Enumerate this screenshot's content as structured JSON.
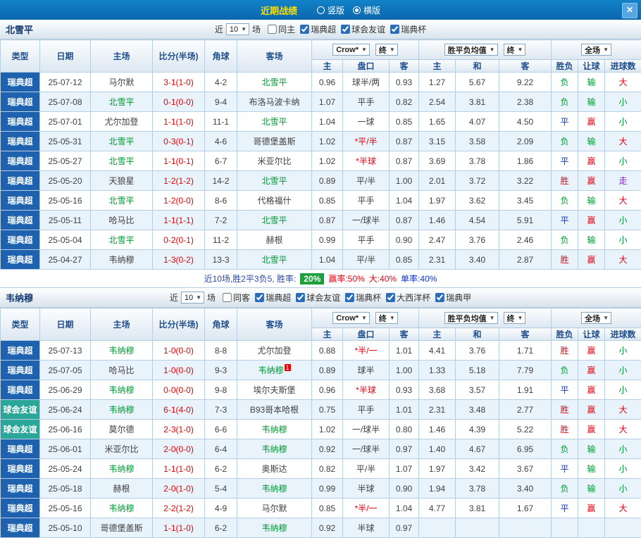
{
  "topbar": {
    "title": "近期战绩",
    "layout_options": [
      {
        "label": "竖版",
        "checked": false
      },
      {
        "label": "横版",
        "checked": true
      }
    ],
    "close_label": "✕"
  },
  "colors": {
    "accent_blue": "#1e61ae",
    "friendly_teal": "#2ba79a",
    "win_red": "#e60012",
    "loss_green": "#009933",
    "draw_blue": "#1133cc",
    "push_purple": "#7d2cc8",
    "title_yellow": "#ffdf00",
    "badge_green": "#1ca03c"
  },
  "sections": [
    {
      "team": "北雪平",
      "filter": {
        "near_label": "近",
        "count_value": "10",
        "games_label": "场",
        "checkboxes": [
          {
            "label": "同主",
            "checked": false
          },
          {
            "label": "瑞典超",
            "checked": true
          },
          {
            "label": "球会友谊",
            "checked": true
          },
          {
            "label": "瑞典杯",
            "checked": true
          }
        ]
      },
      "table": {
        "header": {
          "type": "类型",
          "date": "日期",
          "home": "主场",
          "score": "比分(半场)",
          "corner": "角球",
          "away": "客场",
          "dd_odds": "Crow*",
          "dd_odds_final": "终",
          "dd_avg": "胜平负均值",
          "dd_avg_final": "终",
          "dd_scope": "全场",
          "sub_home": "主",
          "sub_handicap": "盘口",
          "sub_away": "客",
          "sub_avg_home": "主",
          "sub_avg_draw": "和",
          "sub_avg_away": "客",
          "sub_result": "胜负",
          "sub_hcap": "让球",
          "sub_goals": "进球数"
        },
        "rows": [
          {
            "type": "瑞典超",
            "type_cls": "lg-super",
            "date": "25-07-12",
            "home": "马尔默",
            "home_cls": "",
            "score": "3-1(1-0)",
            "corner": "4-2",
            "away": "北雪平",
            "away_cls": "team-focus",
            "away_badge": "",
            "o1": "0.96",
            "hcp": "球半/两",
            "hcp_cls": "",
            "o2": "0.93",
            "a1": "1.27",
            "a2": "5.67",
            "a3": "9.22",
            "res": "负",
            "res_cls": "green",
            "hc": "输",
            "hc_cls": "green",
            "gl": "大",
            "gl_cls": "red"
          },
          {
            "type": "瑞典超",
            "type_cls": "lg-super",
            "date": "25-07-08",
            "home": "北雪平",
            "home_cls": "team-focus",
            "score": "0-1(0-0)",
            "corner": "9-4",
            "away": "布洛马波卡纳",
            "away_cls": "",
            "away_badge": "",
            "o1": "1.07",
            "hcp": "平手",
            "hcp_cls": "",
            "o2": "0.82",
            "a1": "2.54",
            "a2": "3.81",
            "a3": "2.38",
            "res": "负",
            "res_cls": "green",
            "hc": "输",
            "hc_cls": "green",
            "gl": "小",
            "gl_cls": "green"
          },
          {
            "type": "瑞典超",
            "type_cls": "lg-super",
            "date": "25-07-01",
            "home": "尤尔加登",
            "home_cls": "",
            "score": "1-1(1-0)",
            "corner": "11-1",
            "away": "北雪平",
            "away_cls": "team-focus",
            "away_badge": "",
            "o1": "1.04",
            "hcp": "一球",
            "hcp_cls": "",
            "o2": "0.85",
            "a1": "1.65",
            "a2": "4.07",
            "a3": "4.50",
            "res": "平",
            "res_cls": "blue",
            "hc": "赢",
            "hc_cls": "red",
            "gl": "小",
            "gl_cls": "green"
          },
          {
            "type": "瑞典超",
            "type_cls": "lg-super",
            "date": "25-05-31",
            "home": "北雪平",
            "home_cls": "team-focus",
            "score": "0-3(0-1)",
            "corner": "4-6",
            "away": "哥德堡盖斯",
            "away_cls": "",
            "away_badge": "",
            "o1": "1.02",
            "hcp": "*平/半",
            "hcp_cls": "red",
            "o2": "0.87",
            "a1": "3.15",
            "a2": "3.58",
            "a3": "2.09",
            "res": "负",
            "res_cls": "green",
            "hc": "输",
            "hc_cls": "green",
            "gl": "大",
            "gl_cls": "red"
          },
          {
            "type": "瑞典超",
            "type_cls": "lg-super",
            "date": "25-05-27",
            "home": "北雪平",
            "home_cls": "team-focus",
            "score": "1-1(0-1)",
            "corner": "6-7",
            "away": "米亚尔比",
            "away_cls": "",
            "away_badge": "",
            "o1": "1.02",
            "hcp": "*半球",
            "hcp_cls": "red",
            "o2": "0.87",
            "a1": "3.69",
            "a2": "3.78",
            "a3": "1.86",
            "res": "平",
            "res_cls": "blue",
            "hc": "赢",
            "hc_cls": "red",
            "gl": "小",
            "gl_cls": "green"
          },
          {
            "type": "瑞典超",
            "type_cls": "lg-super",
            "date": "25-05-20",
            "home": "天狼星",
            "home_cls": "",
            "score": "1-2(1-2)",
            "corner": "14-2",
            "away": "北雪平",
            "away_cls": "team-focus",
            "away_badge": "",
            "o1": "0.89",
            "hcp": "平/半",
            "hcp_cls": "",
            "o2": "1.00",
            "a1": "2.01",
            "a2": "3.72",
            "a3": "3.22",
            "res": "胜",
            "res_cls": "red",
            "hc": "赢",
            "hc_cls": "red",
            "gl": "走",
            "gl_cls": "purple"
          },
          {
            "type": "瑞典超",
            "type_cls": "lg-super",
            "date": "25-05-16",
            "home": "北雪平",
            "home_cls": "team-focus",
            "score": "1-2(0-0)",
            "corner": "8-6",
            "away": "代格福什",
            "away_cls": "",
            "away_badge": "",
            "o1": "0.85",
            "hcp": "平手",
            "hcp_cls": "",
            "o2": "1.04",
            "a1": "1.97",
            "a2": "3.62",
            "a3": "3.45",
            "res": "负",
            "res_cls": "green",
            "hc": "输",
            "hc_cls": "green",
            "gl": "大",
            "gl_cls": "red"
          },
          {
            "type": "瑞典超",
            "type_cls": "lg-super",
            "date": "25-05-11",
            "home": "哈马比",
            "home_cls": "",
            "score": "1-1(1-1)",
            "corner": "7-2",
            "away": "北雪平",
            "away_cls": "team-focus",
            "away_badge": "",
            "o1": "0.87",
            "hcp": "一/球半",
            "hcp_cls": "",
            "o2": "0.87",
            "a1": "1.46",
            "a2": "4.54",
            "a3": "5.91",
            "res": "平",
            "res_cls": "blue",
            "hc": "赢",
            "hc_cls": "red",
            "gl": "小",
            "gl_cls": "green"
          },
          {
            "type": "瑞典超",
            "type_cls": "lg-super",
            "date": "25-05-04",
            "home": "北雪平",
            "home_cls": "team-focus",
            "score": "0-2(0-1)",
            "corner": "11-2",
            "away": "赫根",
            "away_cls": "",
            "away_badge": "",
            "o1": "0.99",
            "hcp": "平手",
            "hcp_cls": "",
            "o2": "0.90",
            "a1": "2.47",
            "a2": "3.76",
            "a3": "2.46",
            "res": "负",
            "res_cls": "green",
            "hc": "输",
            "hc_cls": "green",
            "gl": "小",
            "gl_cls": "green"
          },
          {
            "type": "瑞典超",
            "type_cls": "lg-super",
            "date": "25-04-27",
            "home": "韦纳穆",
            "home_cls": "",
            "score": "1-3(0-2)",
            "corner": "13-3",
            "away": "北雪平",
            "away_cls": "team-focus",
            "away_badge": "",
            "o1": "1.04",
            "hcp": "平/半",
            "hcp_cls": "",
            "o2": "0.85",
            "a1": "2.31",
            "a2": "3.40",
            "a3": "2.87",
            "res": "胜",
            "res_cls": "red",
            "hc": "赢",
            "hc_cls": "red",
            "gl": "大",
            "gl_cls": "red"
          }
        ]
      },
      "summary": {
        "prefix": "近10场,胜2平3负5, 胜率:",
        "badge": "20%",
        "stats": [
          {
            "text": "赢率:50%",
            "cls": "red"
          },
          {
            "text": "大:40%",
            "cls": "red"
          },
          {
            "text": "单率:40%",
            "cls": "blue"
          }
        ]
      }
    },
    {
      "team": "韦纳穆",
      "filter": {
        "near_label": "近",
        "count_value": "10",
        "games_label": "场",
        "checkboxes": [
          {
            "label": "同客",
            "checked": false
          },
          {
            "label": "瑞典超",
            "checked": true
          },
          {
            "label": "球会友谊",
            "checked": true
          },
          {
            "label": "瑞典杯",
            "checked": true
          },
          {
            "label": "大西洋杯",
            "checked": true
          },
          {
            "label": "瑞典甲",
            "checked": true
          }
        ]
      },
      "table": {
        "header": {
          "type": "类型",
          "date": "日期",
          "home": "主场",
          "score": "比分(半场)",
          "corner": "角球",
          "away": "客场",
          "dd_odds": "Crow*",
          "dd_odds_final": "终",
          "dd_avg": "胜平负均值",
          "dd_avg_final": "终",
          "dd_scope": "全场",
          "sub_home": "主",
          "sub_handicap": "盘口",
          "sub_away": "客",
          "sub_avg_home": "主",
          "sub_avg_draw": "和",
          "sub_avg_away": "客",
          "sub_result": "胜负",
          "sub_hcap": "让球",
          "sub_goals": "进球数"
        },
        "rows": [
          {
            "type": "瑞典超",
            "type_cls": "lg-super",
            "date": "25-07-13",
            "home": "韦纳穆",
            "home_cls": "team-focus",
            "score": "1-0(0-0)",
            "corner": "8-8",
            "away": "尤尔加登",
            "away_cls": "",
            "away_badge": "",
            "o1": "0.88",
            "hcp": "*半/一",
            "hcp_cls": "red",
            "o2": "1.01",
            "a1": "4.41",
            "a2": "3.76",
            "a3": "1.71",
            "res": "胜",
            "res_cls": "red",
            "hc": "赢",
            "hc_cls": "red",
            "gl": "小",
            "gl_cls": "green"
          },
          {
            "type": "瑞典超",
            "type_cls": "lg-super",
            "date": "25-07-05",
            "home": "哈马比",
            "home_cls": "",
            "score": "1-0(0-0)",
            "corner": "9-3",
            "away": "韦纳穆",
            "away_cls": "team-focus",
            "away_badge": "1",
            "o1": "0.89",
            "hcp": "球半",
            "hcp_cls": "",
            "o2": "1.00",
            "a1": "1.33",
            "a2": "5.18",
            "a3": "7.79",
            "res": "负",
            "res_cls": "green",
            "hc": "赢",
            "hc_cls": "red",
            "gl": "小",
            "gl_cls": "green"
          },
          {
            "type": "瑞典超",
            "type_cls": "lg-super",
            "date": "25-06-29",
            "home": "韦纳穆",
            "home_cls": "team-focus",
            "score": "0-0(0-0)",
            "corner": "9-8",
            "away": "埃尔夫斯堡",
            "away_cls": "",
            "away_badge": "",
            "o1": "0.96",
            "hcp": "*半球",
            "hcp_cls": "red",
            "o2": "0.93",
            "a1": "3.68",
            "a2": "3.57",
            "a3": "1.91",
            "res": "平",
            "res_cls": "blue",
            "hc": "赢",
            "hc_cls": "red",
            "gl": "小",
            "gl_cls": "green"
          },
          {
            "type": "球会友谊",
            "type_cls": "lg-friendly",
            "date": "25-06-24",
            "home": "韦纳穆",
            "home_cls": "team-focus",
            "score": "6-1(4-0)",
            "corner": "7-3",
            "away": "B93哥本哈根",
            "away_cls": "",
            "away_badge": "",
            "o1": "0.75",
            "hcp": "平手",
            "hcp_cls": "",
            "o2": "1.01",
            "a1": "2.31",
            "a2": "3.48",
            "a3": "2.77",
            "res": "胜",
            "res_cls": "red",
            "hc": "赢",
            "hc_cls": "red",
            "gl": "大",
            "gl_cls": "red"
          },
          {
            "type": "球会友谊",
            "type_cls": "lg-friendly",
            "date": "25-06-16",
            "home": "莫尔德",
            "home_cls": "",
            "score": "2-3(1-0)",
            "corner": "6-6",
            "away": "韦纳穆",
            "away_cls": "team-focus",
            "away_badge": "",
            "o1": "1.02",
            "hcp": "一/球半",
            "hcp_cls": "",
            "o2": "0.80",
            "a1": "1.46",
            "a2": "4.39",
            "a3": "5.22",
            "res": "胜",
            "res_cls": "red",
            "hc": "赢",
            "hc_cls": "red",
            "gl": "大",
            "gl_cls": "red"
          },
          {
            "type": "瑞典超",
            "type_cls": "lg-super",
            "date": "25-06-01",
            "home": "米亚尔比",
            "home_cls": "",
            "score": "2-0(0-0)",
            "corner": "6-4",
            "away": "韦纳穆",
            "away_cls": "team-focus",
            "away_badge": "",
            "o1": "0.92",
            "hcp": "一/球半",
            "hcp_cls": "",
            "o2": "0.97",
            "a1": "1.40",
            "a2": "4.67",
            "a3": "6.95",
            "res": "负",
            "res_cls": "green",
            "hc": "输",
            "hc_cls": "green",
            "gl": "小",
            "gl_cls": "green"
          },
          {
            "type": "瑞典超",
            "type_cls": "lg-super",
            "date": "25-05-24",
            "home": "韦纳穆",
            "home_cls": "team-focus",
            "score": "1-1(1-0)",
            "corner": "6-2",
            "away": "奥斯达",
            "away_cls": "",
            "away_badge": "",
            "o1": "0.82",
            "hcp": "平/半",
            "hcp_cls": "",
            "o2": "1.07",
            "a1": "1.97",
            "a2": "3.42",
            "a3": "3.67",
            "res": "平",
            "res_cls": "blue",
            "hc": "输",
            "hc_cls": "green",
            "gl": "小",
            "gl_cls": "green"
          },
          {
            "type": "瑞典超",
            "type_cls": "lg-super",
            "date": "25-05-18",
            "home": "赫根",
            "home_cls": "",
            "score": "2-0(1-0)",
            "corner": "5-4",
            "away": "韦纳穆",
            "away_cls": "team-focus",
            "away_badge": "",
            "o1": "0.99",
            "hcp": "半球",
            "hcp_cls": "",
            "o2": "0.90",
            "a1": "1.94",
            "a2": "3.78",
            "a3": "3.40",
            "res": "负",
            "res_cls": "green",
            "hc": "输",
            "hc_cls": "green",
            "gl": "小",
            "gl_cls": "green"
          },
          {
            "type": "瑞典超",
            "type_cls": "lg-super",
            "date": "25-05-16",
            "home": "韦纳穆",
            "home_cls": "team-focus",
            "score": "2-2(1-2)",
            "corner": "4-9",
            "away": "马尔默",
            "away_cls": "",
            "away_badge": "",
            "o1": "0.85",
            "hcp": "*半/一",
            "hcp_cls": "red",
            "o2": "1.04",
            "a1": "4.77",
            "a2": "3.81",
            "a3": "1.67",
            "res": "平",
            "res_cls": "blue",
            "hc": "赢",
            "hc_cls": "red",
            "gl": "大",
            "gl_cls": "red"
          },
          {
            "type": "瑞典超",
            "type_cls": "lg-super",
            "date": "25-05-10",
            "home": "哥德堡盖斯",
            "home_cls": "",
            "score": "1-1(1-0)",
            "corner": "6-2",
            "away": "韦纳穆",
            "away_cls": "team-focus",
            "away_badge": "",
            "o1": "0.92",
            "hcp": "半球",
            "hcp_cls": "",
            "o2": "0.97",
            "a1": "",
            "a2": "",
            "a3": "",
            "res": "",
            "res_cls": "",
            "hc": "",
            "hc_cls": "",
            "gl": "",
            "gl_cls": ""
          }
        ]
      },
      "summary": null
    }
  ]
}
